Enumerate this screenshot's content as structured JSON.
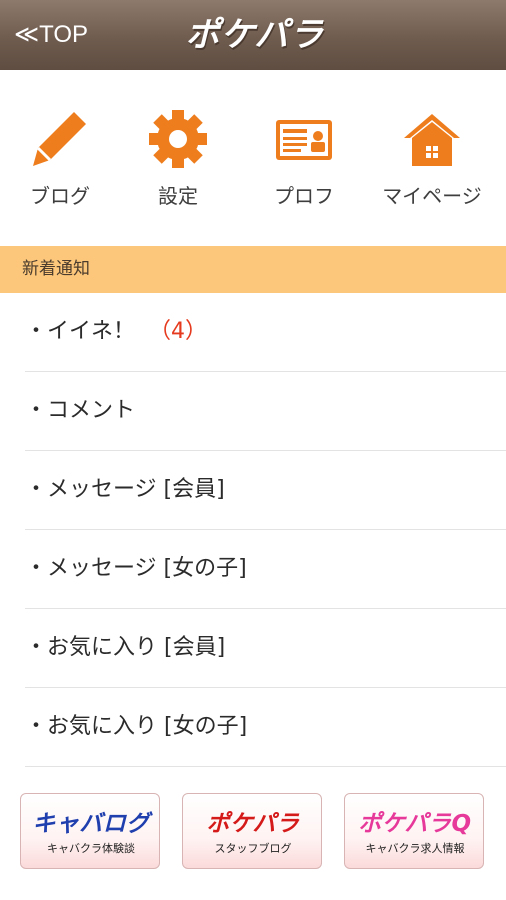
{
  "header": {
    "back_label": "≪TOP",
    "logo_text": "ポケパラ"
  },
  "nav": [
    {
      "label": "ブログ",
      "icon": "pencil-icon"
    },
    {
      "label": "設定",
      "icon": "gear-icon"
    },
    {
      "label": "プロフ",
      "icon": "profile-card-icon"
    },
    {
      "label": "マイページ",
      "icon": "house-icon"
    }
  ],
  "notifications": {
    "title": "新着通知",
    "items": [
      {
        "label": "・イイネ！",
        "count": "（4）"
      },
      {
        "label": "・コメント"
      },
      {
        "label": "・メッセージ [会員]"
      },
      {
        "label": "・メッセージ [女の子]"
      },
      {
        "label": "・お気に入り [会員]"
      },
      {
        "label": "・お気に入り [女の子]"
      }
    ]
  },
  "banners": [
    {
      "logo": "キャバログ",
      "sub": "キャバクラ体験談",
      "color": "#1f3fae"
    },
    {
      "logo": "ポケパラ",
      "sub": "スタッフブログ",
      "color": "#d51a1a"
    },
    {
      "logo": "ポケパラQ",
      "sub": "キャバクラ求人情報",
      "color": "#e6399a"
    }
  ],
  "colors": {
    "accent": "#ee7d1d",
    "header_bg": "#6f5c4f",
    "section_bg": "#fcc77a",
    "count": "#e53a1e"
  }
}
